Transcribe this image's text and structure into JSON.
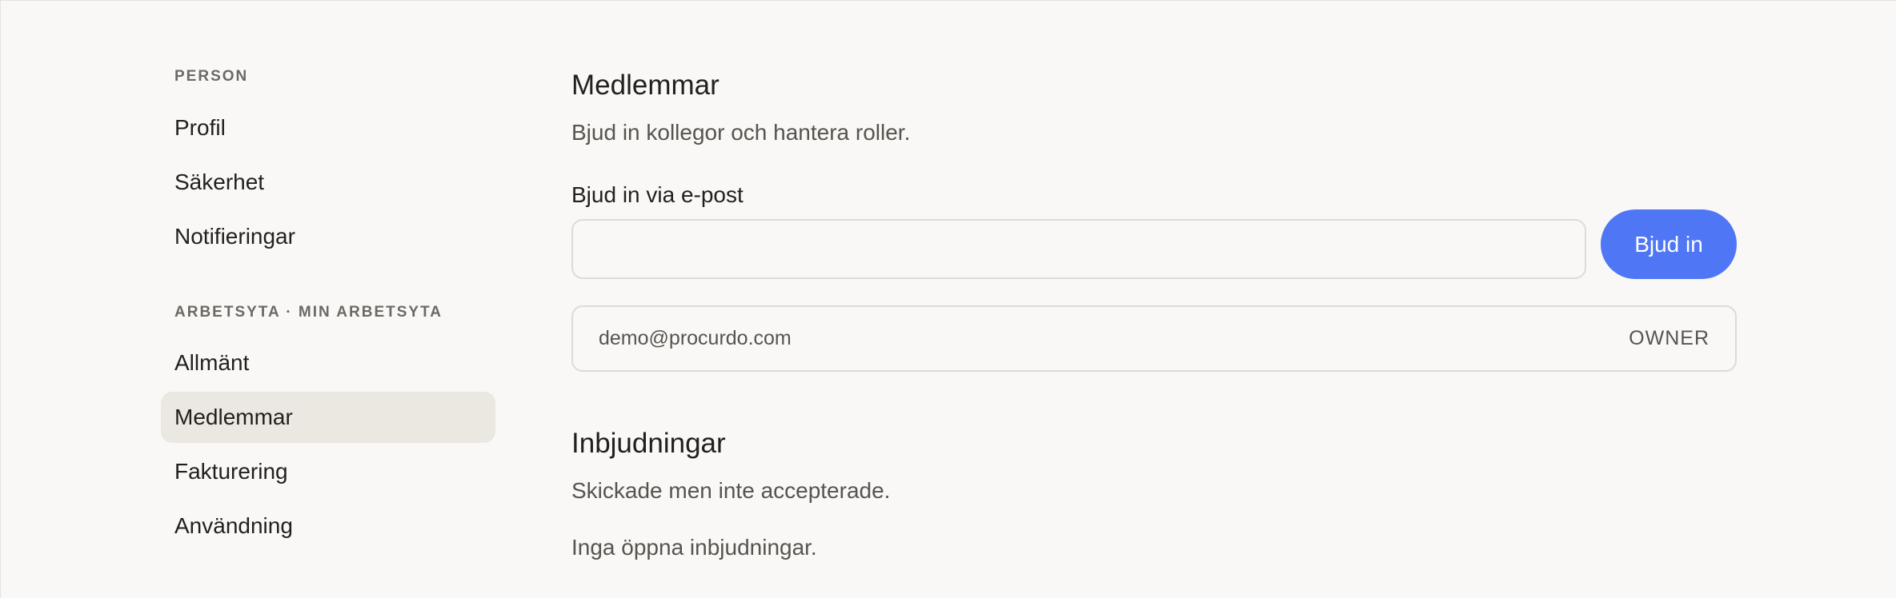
{
  "sidebar": {
    "person_label": "PERSON",
    "person_items": [
      "Profil",
      "Säkerhet",
      "Notifieringar"
    ],
    "workspace_label": "ARBETSYTA · MIN ARBETSYTA",
    "workspace_items": [
      "Allmänt",
      "Medlemmar",
      "Fakturering",
      "Användning"
    ],
    "active_item": "Medlemmar"
  },
  "members": {
    "title": "Medlemmar",
    "subtitle": "Bjud in kollegor och hantera roller.",
    "invite_label": "Bjud in via e-post",
    "invite_value": "",
    "invite_button": "Bjud in",
    "list": [
      {
        "email": "demo@procurdo.com",
        "role": "OWNER"
      }
    ]
  },
  "invitations": {
    "title": "Inbjudningar",
    "subtitle": "Skickade men inte accepterade.",
    "empty_text": "Inga öppna inbjudningar."
  },
  "colors": {
    "background": "#f9f8f6",
    "accent": "#4f76f5",
    "active_nav": "#ebe8e2"
  }
}
